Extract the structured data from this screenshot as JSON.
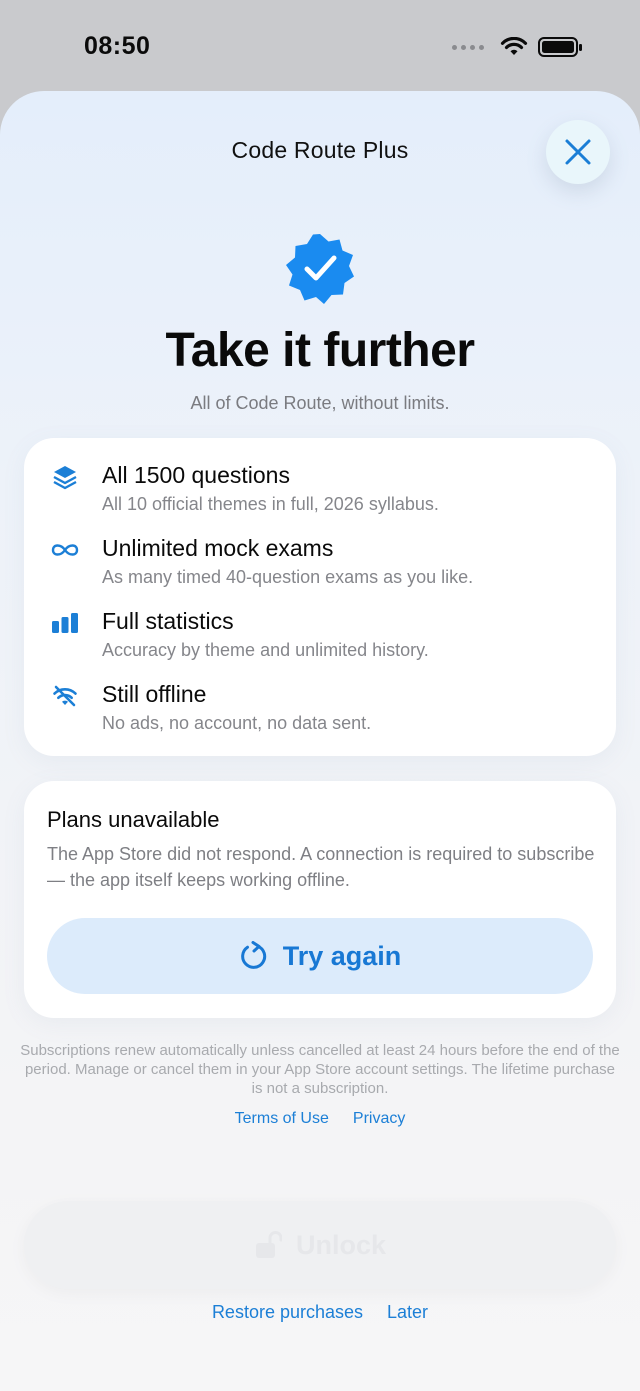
{
  "status_bar": {
    "time": "08:50"
  },
  "header": {
    "title": "Code Route Plus"
  },
  "hero": {
    "title": "Take it further",
    "subtitle": "All of Code Route, without limits."
  },
  "features": [
    {
      "icon": "layers-icon",
      "title": "All 1500 questions",
      "description": "All 10 official themes in full, 2026 syllabus."
    },
    {
      "icon": "infinity-icon",
      "title": "Unlimited mock exams",
      "description": "As many timed 40-question exams as you like."
    },
    {
      "icon": "bar-chart-icon",
      "title": "Full statistics",
      "description": "Accuracy by theme and unlimited history."
    },
    {
      "icon": "wifi-off-icon",
      "title": "Still offline",
      "description": "No ads, no account, no data sent."
    }
  ],
  "plans": {
    "title": "Plans unavailable",
    "message": "The App Store did not respond. A connection is required to subscribe — the app itself keeps working offline.",
    "retry_label": "Try again"
  },
  "legal": {
    "text": "Subscriptions renew automatically unless cancelled at least 24 hours before the end of the period. Manage or cancel them in your App Store account settings. The lifetime purchase is not a subscription.",
    "terms_label": "Terms of Use",
    "privacy_label": "Privacy"
  },
  "unlock": {
    "label": "Unlock",
    "enabled": false
  },
  "footer": {
    "restore_label": "Restore purchases",
    "later_label": "Later"
  },
  "colors": {
    "accent": "#1c7fd6",
    "badge": "#1a8bf0",
    "retry_bg": "#dcebfb"
  }
}
